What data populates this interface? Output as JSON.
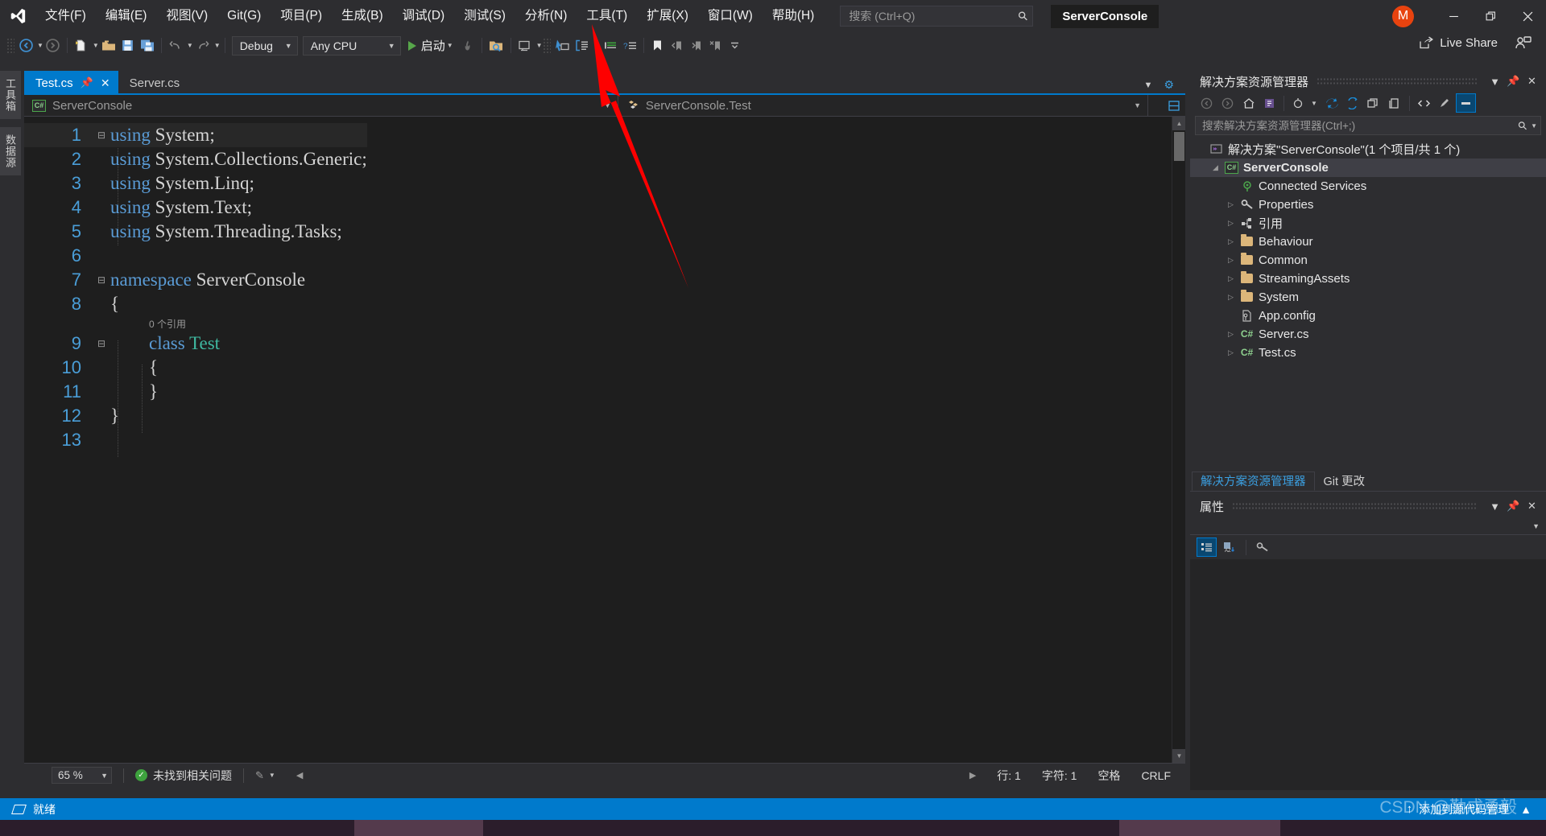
{
  "titlebar": {
    "logo_icon": "visual-studio-logo",
    "menus": [
      {
        "label": "文件(F)",
        "mnemonic": "F"
      },
      {
        "label": "编辑(E)",
        "mnemonic": "E"
      },
      {
        "label": "视图(V)",
        "mnemonic": "V"
      },
      {
        "label": "Git(G)",
        "mnemonic": "G"
      },
      {
        "label": "项目(P)",
        "mnemonic": "P"
      },
      {
        "label": "生成(B)",
        "mnemonic": "B"
      },
      {
        "label": "调试(D)",
        "mnemonic": "D"
      },
      {
        "label": "测试(S)",
        "mnemonic": "S"
      },
      {
        "label": "分析(N)",
        "mnemonic": "N"
      },
      {
        "label": "工具(T)",
        "mnemonic": "T"
      },
      {
        "label": "扩展(X)",
        "mnemonic": "X"
      },
      {
        "label": "窗口(W)",
        "mnemonic": "W"
      },
      {
        "label": "帮助(H)",
        "mnemonic": "H"
      }
    ],
    "search_placeholder": "搜索 (Ctrl+Q)",
    "search_value": "",
    "search_icon": "search-icon",
    "project_title": "ServerConsole",
    "avatar_initial": "M",
    "avatar_color": "#e8430f",
    "minimize_icon": "minimize-icon",
    "restore_icon": "restore-icon",
    "close_icon": "close-icon"
  },
  "toolbar": {
    "back_icon": "navigate-back-icon",
    "forward_icon": "navigate-forward-icon",
    "new_icon": "new-file-icon",
    "open_icon": "open-folder-icon",
    "save_icon": "save-icon",
    "save_all_icon": "save-all-icon",
    "undo_icon": "undo-icon",
    "redo_icon": "redo-icon",
    "config_value": "Debug",
    "platform_value": "Any CPU",
    "start_label": "启动",
    "start_icon": "play-icon",
    "hot_reload_icon": "hot-reload-icon",
    "find_in_files_icon": "find-in-files-icon",
    "window_icon": "window-layout-icon",
    "pointer_icon": "pointer-select-icon",
    "structure_icon": "structure-icon",
    "indent_icon": "indent-icon",
    "comment_icon": "comment-icon",
    "bookmark_icon": "bookmark-icon",
    "prev_bookmark_icon": "prev-bookmark-icon",
    "next_bookmark_icon": "next-bookmark-icon",
    "clear_bookmark_icon": "clear-bookmark-icon",
    "overflow_icon": "toolbar-overflow-icon",
    "live_share_label": "Live Share",
    "live_share_icon": "live-share-icon",
    "live_share_people_icon": "live-share-people-icon"
  },
  "left_strip": {
    "tabs": [
      {
        "label": "工具箱"
      },
      {
        "label": "数据源"
      }
    ]
  },
  "editor": {
    "tabs": [
      {
        "label": "Test.cs",
        "active": true,
        "pinned": true,
        "closable": true
      },
      {
        "label": "Server.cs",
        "active": false,
        "pinned": false,
        "closable": false
      }
    ],
    "tab_overflow_icon": "tab-overflow-icon",
    "tab_settings_icon": "tab-settings-icon",
    "nav_left": "ServerConsole",
    "nav_left_icon": "csharp-project-icon",
    "nav_right": "ServerConsole.Test",
    "nav_right_icon": "class-icon",
    "split_icon": "split-view-icon",
    "codelens_text": "0 个引用",
    "bulb_icon": "lightbulb-icon",
    "lines": [
      {
        "n": "1",
        "glyph": "collapse",
        "bulb": true,
        "tokens": [
          {
            "t": "using",
            "c": "kw"
          },
          {
            "t": " System;",
            "c": "plain"
          }
        ]
      },
      {
        "n": "2",
        "glyph": "",
        "bulb": false,
        "tokens": [
          {
            "t": "using",
            "c": "kw"
          },
          {
            "t": " System.Collections.Generic;",
            "c": "plain"
          }
        ]
      },
      {
        "n": "3",
        "glyph": "",
        "bulb": false,
        "tokens": [
          {
            "t": "using",
            "c": "kw"
          },
          {
            "t": " System.Linq;",
            "c": "plain"
          }
        ]
      },
      {
        "n": "4",
        "glyph": "",
        "bulb": false,
        "tokens": [
          {
            "t": "using",
            "c": "kw"
          },
          {
            "t": " System.Text;",
            "c": "plain"
          }
        ]
      },
      {
        "n": "5",
        "glyph": "",
        "bulb": false,
        "tokens": [
          {
            "t": "using",
            "c": "kw"
          },
          {
            "t": " System.Threading.Tasks;",
            "c": "plain"
          }
        ]
      },
      {
        "n": "6",
        "glyph": "",
        "bulb": false,
        "tokens": []
      },
      {
        "n": "7",
        "glyph": "collapse",
        "bulb": false,
        "tokens": [
          {
            "t": "namespace",
            "c": "kw"
          },
          {
            "t": " ServerConsole",
            "c": "plain"
          }
        ]
      },
      {
        "n": "8",
        "glyph": "",
        "bulb": false,
        "tokens": [
          {
            "t": "{",
            "c": "punct"
          }
        ]
      },
      {
        "n": "9",
        "glyph": "collapse",
        "bulb": false,
        "codelens": true,
        "indent": 2,
        "tokens": [
          {
            "t": "class",
            "c": "kw"
          },
          {
            "t": " ",
            "c": "plain"
          },
          {
            "t": "Test",
            "c": "type-green"
          }
        ]
      },
      {
        "n": "10",
        "glyph": "",
        "bulb": false,
        "indent": 2,
        "tokens": [
          {
            "t": "{",
            "c": "punct"
          }
        ]
      },
      {
        "n": "11",
        "glyph": "",
        "bulb": false,
        "indent": 2,
        "tokens": [
          {
            "t": "}",
            "c": "punct"
          }
        ]
      },
      {
        "n": "12",
        "glyph": "",
        "bulb": false,
        "tokens": [
          {
            "t": "}",
            "c": "punct"
          }
        ]
      },
      {
        "n": "13",
        "glyph": "",
        "bulb": false,
        "tokens": []
      }
    ],
    "status": {
      "zoom": "65 %",
      "issues_icon": "check-circle-icon",
      "issues_text": "未找到相关问题",
      "pen_icon": "ink-annotation-icon",
      "line_label": "行: 1",
      "char_label": "字符: 1",
      "space_label": "空格",
      "eol_label": "CRLF"
    }
  },
  "solution_explorer": {
    "title": "解决方案资源管理器",
    "dropdown_icon": "chevron-down-icon",
    "pin_icon": "pin-icon",
    "close_icon": "close-icon",
    "toolbar_icons": [
      "navigate-back-icon",
      "navigate-forward-icon",
      "home-icon",
      "pending-changes-icon",
      "sync-with-active-document-icon",
      "refresh-icon",
      "collapse-all-icon",
      "show-all-files-icon",
      "properties-window-icon",
      "code-view-icon",
      "designer-view-icon",
      "preview-selected-items-icon"
    ],
    "search_placeholder": "搜索解决方案资源管理器(Ctrl+;)",
    "search_value": "",
    "search_icon": "search-icon",
    "tree": [
      {
        "label": "解决方案\"ServerConsole\"(1 个项目/共 1 个)",
        "icon": "solution-icon",
        "indent": 0,
        "expander": "",
        "selected": false,
        "bold": false
      },
      {
        "label": "ServerConsole",
        "icon": "csharp-project-icon",
        "indent": 1,
        "expander": "expanded",
        "selected": true,
        "bold": true
      },
      {
        "label": "Connected Services",
        "icon": "connected-services-icon",
        "indent": 2,
        "expander": "",
        "selected": false,
        "bold": false
      },
      {
        "label": "Properties",
        "icon": "wrench-icon",
        "indent": 2,
        "expander": "collapsed",
        "selected": false,
        "bold": false
      },
      {
        "label": "引用",
        "icon": "references-icon",
        "indent": 2,
        "expander": "collapsed",
        "selected": false,
        "bold": false
      },
      {
        "label": "Behaviour",
        "icon": "folder-icon",
        "indent": 2,
        "expander": "collapsed",
        "selected": false,
        "bold": false
      },
      {
        "label": "Common",
        "icon": "folder-icon",
        "indent": 2,
        "expander": "collapsed",
        "selected": false,
        "bold": false
      },
      {
        "label": "StreamingAssets",
        "icon": "folder-icon",
        "indent": 2,
        "expander": "collapsed",
        "selected": false,
        "bold": false
      },
      {
        "label": "System",
        "icon": "folder-icon",
        "indent": 2,
        "expander": "collapsed",
        "selected": false,
        "bold": false
      },
      {
        "label": "App.config",
        "icon": "config-file-icon",
        "indent": 2,
        "expander": "",
        "selected": false,
        "bold": false
      },
      {
        "label": "Server.cs",
        "icon": "csharp-file-icon",
        "indent": 2,
        "expander": "collapsed",
        "selected": false,
        "bold": false
      },
      {
        "label": "Test.cs",
        "icon": "csharp-file-icon",
        "indent": 2,
        "expander": "collapsed",
        "selected": false,
        "bold": false
      }
    ],
    "bottom_tabs": [
      {
        "label": "解决方案资源管理器",
        "active": true
      },
      {
        "label": "Git 更改",
        "active": false
      }
    ]
  },
  "properties_pane": {
    "title": "属性",
    "dropdown_icon": "chevron-down-icon",
    "pin_icon": "pin-icon",
    "close_icon": "close-icon",
    "object_selector_value": "",
    "toolbar_icons": [
      "categorized-icon",
      "alphabetical-icon",
      "properties-icon"
    ]
  },
  "statusbar": {
    "ready_text": "就绪",
    "ready_icon": "ready-icon",
    "source_control_text": "添加到源代码管理",
    "source_control_icon": "upload-arrow-icon",
    "notification_icon": "notification-bell-icon",
    "accent_color": "#007acc"
  },
  "annotation": {
    "arrow_color": "#fe0000",
    "arrow_name": "red-pointer-arrow",
    "points_to": "工具(T)"
  },
  "watermark": {
    "text": "CSDN @勤成勇毅"
  }
}
